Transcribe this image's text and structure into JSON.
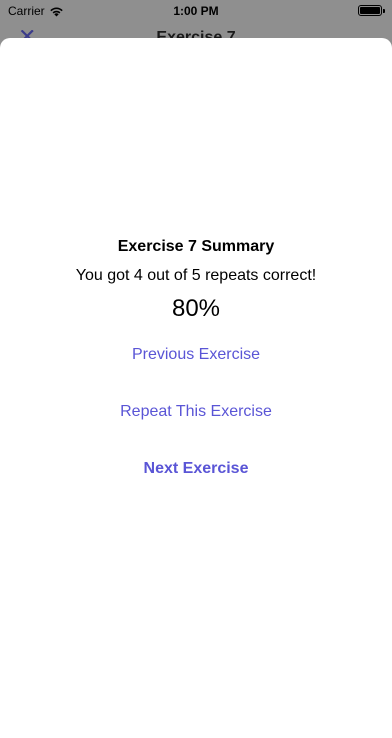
{
  "status_bar": {
    "carrier": "Carrier",
    "time": "1:00 PM"
  },
  "background_screen": {
    "title": "Exercise 7"
  },
  "summary": {
    "title": "Exercise 7 Summary",
    "result": "You got 4 out of 5 repeats correct!",
    "percent": "80%"
  },
  "actions": {
    "previous": "Previous Exercise",
    "repeat": "Repeat This Exercise",
    "next": "Next Exercise"
  },
  "colors": {
    "accent": "#5a55d6",
    "dimmed_background": "#8f8f8f",
    "sheet": "#ffffff"
  }
}
